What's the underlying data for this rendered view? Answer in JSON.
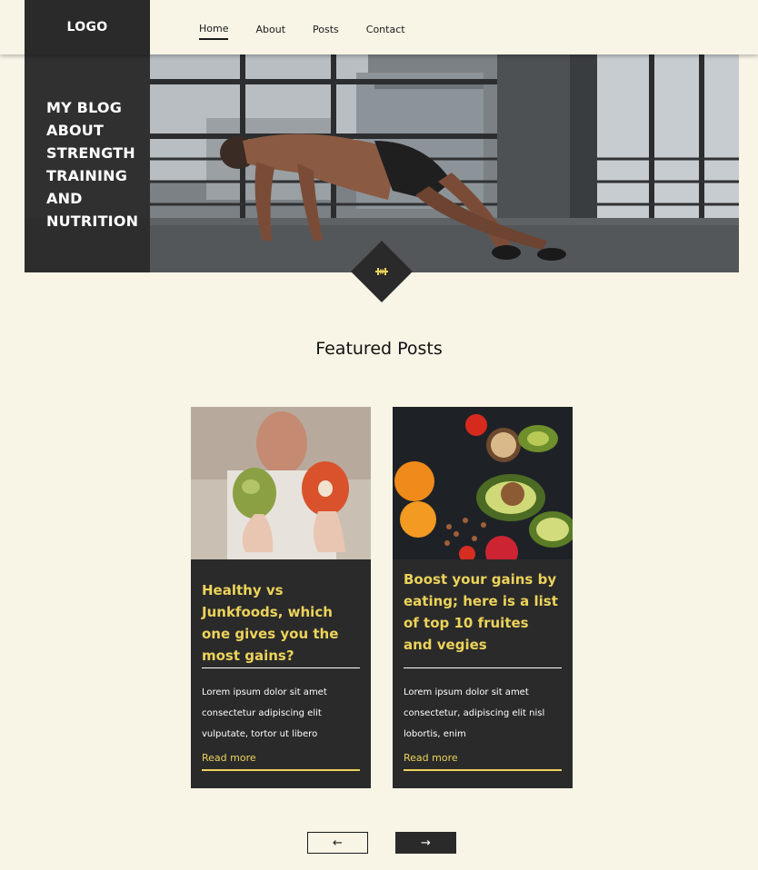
{
  "header": {
    "logo": "LOGO",
    "nav": [
      "Home",
      "About",
      "Posts",
      "Contact"
    ],
    "active_nav": "Home"
  },
  "hero": {
    "title": "MY BLOG ABOUT STRENGTH TRAINING AND NUTRITION",
    "badge_icon": "dumbbell-icon"
  },
  "featured": {
    "title": "Featured Posts",
    "posts": [
      {
        "title": "Healthy vs Junkfoods, which one gives you the most gains?",
        "excerpt": "Lorem ipsum dolor sit amet consectetur adipiscing elit vulputate, tortor ut libero",
        "link": "Read more",
        "image": "apple-and-donut-photo"
      },
      {
        "title": "Boost your gains by eating; here is a list of top 10 fruites and vegies",
        "excerpt": "Lorem ipsum dolor sit amet consectetur, adipiscing elit nisl lobortis, enim",
        "link": "Read more",
        "image": "fruits-and-vegetables-photo"
      }
    ]
  },
  "pager": {
    "prev": "←",
    "next": "→"
  },
  "colors": {
    "background": "#f8f4e6",
    "dark": "#2a2a2a",
    "accent": "#ecd35a"
  }
}
